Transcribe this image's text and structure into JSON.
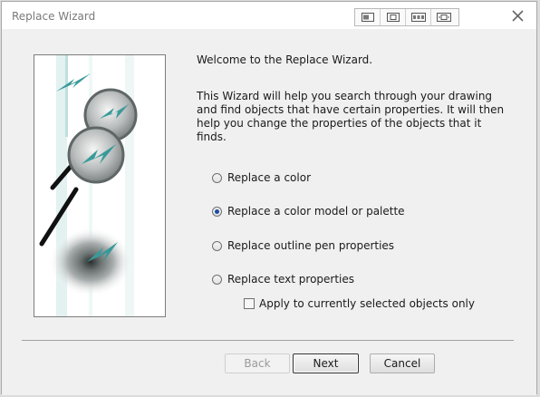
{
  "window": {
    "title": "Replace Wizard"
  },
  "titlebar": {
    "icons": [
      "view-mode-1-icon",
      "view-mode-2-icon",
      "view-mode-3-icon",
      "view-mode-4-icon"
    ],
    "close_glyph": "✕"
  },
  "main": {
    "welcome": "Welcome to the Replace Wizard.",
    "description": "This Wizard will help you search through your drawing and find objects that have certain properties. It will then help you change the properties of the objects that it finds.",
    "options": [
      {
        "label": "Replace a color",
        "checked": false
      },
      {
        "label": "Replace a color model or palette",
        "checked": true
      },
      {
        "label": "Replace outline pen properties",
        "checked": false
      },
      {
        "label": "Replace text properties",
        "checked": false
      }
    ],
    "apply_selected": {
      "label": "Apply to currently selected objects only",
      "checked": false
    }
  },
  "buttons": {
    "back": "Back",
    "next": "Next",
    "cancel": "Cancel"
  },
  "colors": {
    "accent": "#1c4ea0",
    "teal_arrow": "#3a9a9a",
    "title_text": "#7a7a7a"
  }
}
